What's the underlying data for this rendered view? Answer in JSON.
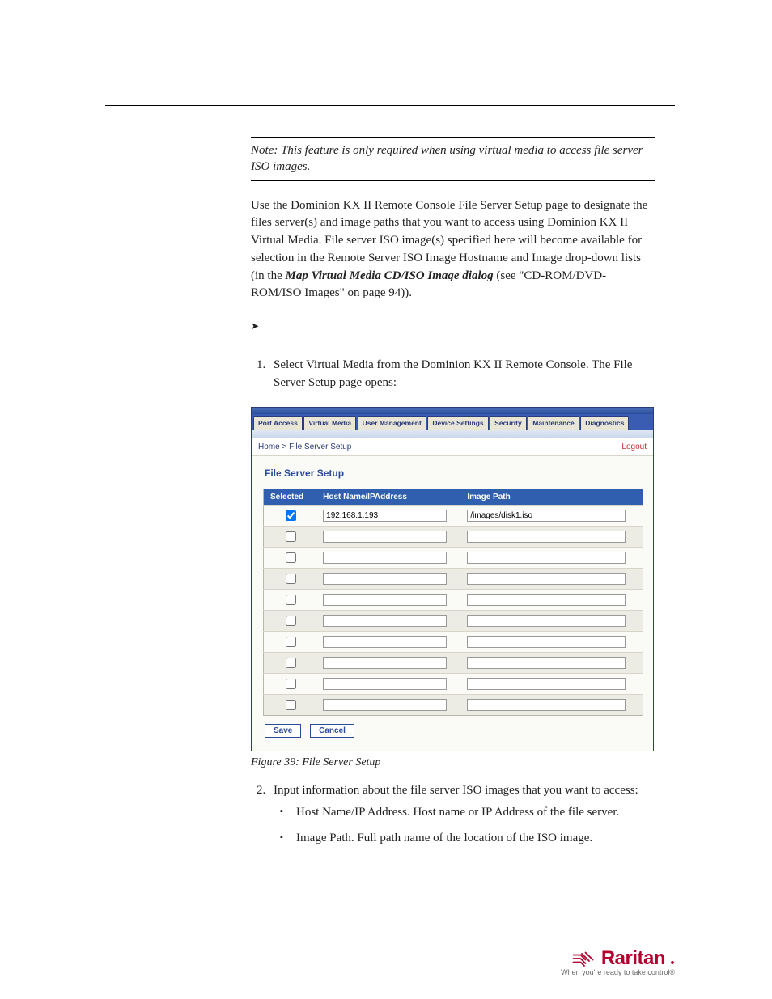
{
  "noteText": "Note: This feature is only required when using virtual media to access file server ISO images.",
  "intro": {
    "pre": "Use the Dominion KX II Remote Console File Server Setup page to designate the files server(s) and image paths that you want to access using Dominion KX II Virtual Media. File server ISO image(s) specified here will become available for selection in the Remote Server ISO Image Hostname and Image drop-down lists (in the ",
    "bold": "Map Virtual Media CD/ISO Image dialog",
    "post": " (see \"CD-ROM/DVD-ROM/ISO Images\" on page 94))."
  },
  "chevron": "➤",
  "step1": "Select Virtual Media from the Dominion KX II Remote Console. The File Server Setup page opens:",
  "figureCaption": "Figure 39: File Server Setup",
  "step2": "Input information about the file server ISO images that you want to access:",
  "bullet1": "Host Name/IP Address. Host name or IP Address of the file server.",
  "bullet2": "Image Path. Full path name of the location of the ISO image.",
  "app": {
    "tabs": [
      "Port Access",
      "Virtual Media",
      "User Management",
      "Device Settings",
      "Security",
      "Maintenance",
      "Diagnostics"
    ],
    "crumbHome": "Home",
    "crumbSep": " > ",
    "crumbPage": "File Server Setup",
    "logout": "Logout",
    "title": "File Server Setup",
    "thSelected": "Selected",
    "thHost": "Host Name/IPAddress",
    "thPath": "Image Path",
    "rows": [
      {
        "selected": true,
        "host": "192.168.1.193",
        "path": "/images/disk1.iso"
      },
      {
        "selected": false,
        "host": "",
        "path": ""
      },
      {
        "selected": false,
        "host": "",
        "path": ""
      },
      {
        "selected": false,
        "host": "",
        "path": ""
      },
      {
        "selected": false,
        "host": "",
        "path": ""
      },
      {
        "selected": false,
        "host": "",
        "path": ""
      },
      {
        "selected": false,
        "host": "",
        "path": ""
      },
      {
        "selected": false,
        "host": "",
        "path": ""
      },
      {
        "selected": false,
        "host": "",
        "path": ""
      },
      {
        "selected": false,
        "host": "",
        "path": ""
      }
    ],
    "saveLabel": "Save",
    "cancelLabel": "Cancel"
  },
  "brand": {
    "name": "Raritan",
    "tagline": "When you're ready to take control®"
  }
}
